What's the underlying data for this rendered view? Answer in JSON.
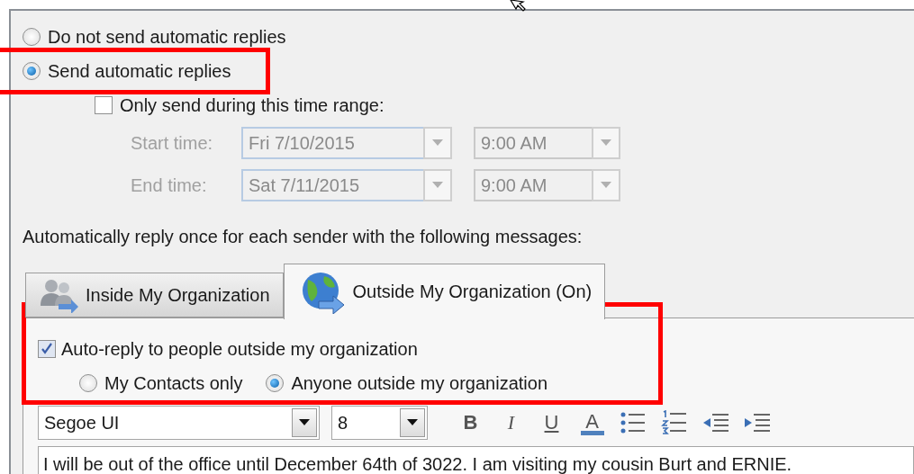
{
  "reply_mode": [
    {
      "label": "Do not send automatic replies",
      "selected": false
    },
    {
      "label": "Send automatic replies",
      "selected": true
    }
  ],
  "time_range": {
    "label": "Only send during this time range:",
    "checked": false,
    "rows": [
      {
        "label": "Start time:",
        "date": "Fri 7/10/2015",
        "time": "9:00 AM"
      },
      {
        "label": "End time:",
        "date": "Sat 7/11/2015",
        "time": "9:00 AM"
      }
    ]
  },
  "instruction": "Automatically reply once for each sender with the following messages:",
  "tabs": [
    {
      "label": "Inside My Organization",
      "selected": false,
      "kind": "people"
    },
    {
      "label": "Outside My Organization (On)",
      "selected": true,
      "kind": "globe"
    }
  ],
  "auto_reply": {
    "label": "Auto-reply to people outside my organization",
    "checked": true
  },
  "audience": [
    {
      "label": "My Contacts only",
      "selected": false
    },
    {
      "label": "Anyone outside my organization",
      "selected": true
    }
  ],
  "toolbar": {
    "font": "Segoe UI",
    "size": "8",
    "format_buttons": [
      {
        "label": "B",
        "kind": "bold"
      },
      {
        "label": "I",
        "kind": "italic"
      },
      {
        "label": "U",
        "kind": "underline"
      },
      {
        "label": "A",
        "kind": "color"
      }
    ]
  },
  "message": "I will be out of the office until December 64th of 3022. I am visiting my cousin Burt and ERNIE."
}
